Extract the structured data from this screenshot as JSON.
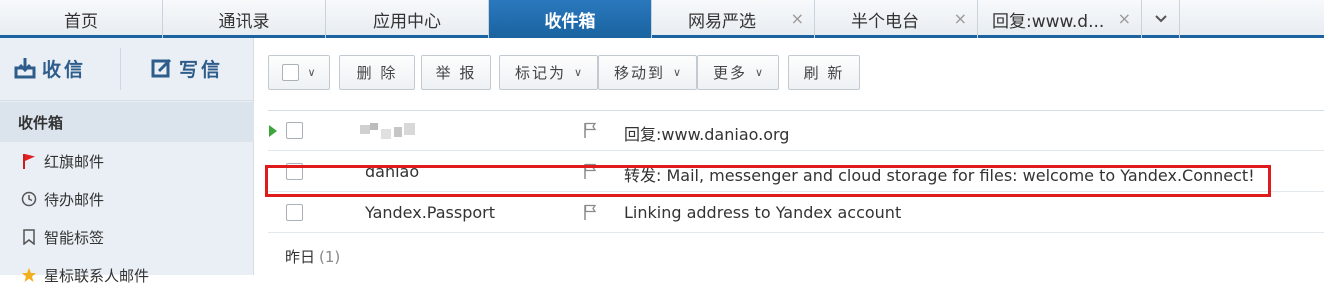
{
  "tabs": [
    {
      "label": "首页"
    },
    {
      "label": "通讯录"
    },
    {
      "label": "应用中心"
    },
    {
      "label": "收件箱"
    },
    {
      "label": "网易严选"
    },
    {
      "label": "半个电台"
    },
    {
      "label": "回复:www.d..."
    }
  ],
  "tab_close_symbol": "×",
  "sidebar": {
    "receive_label": "收信",
    "compose_label": "写信",
    "items": [
      {
        "label": "收件箱"
      },
      {
        "label": "红旗邮件",
        "icon": "red-flag-icon"
      },
      {
        "label": "待办邮件",
        "icon": "clock-icon"
      },
      {
        "label": "智能标签",
        "icon": "bookmark-icon"
      },
      {
        "label": "星标联系人邮件",
        "icon": "star-icon"
      }
    ]
  },
  "toolbar": {
    "delete_label": "删 除",
    "report_label": "举 报",
    "mark_as_label": "标记为",
    "move_to_label": "移动到",
    "more_label": "更多",
    "refresh_label": "刷 新",
    "caret": "∨"
  },
  "mails": [
    {
      "sender": "",
      "subject": "回复:www.daniao.org",
      "unread": true
    },
    {
      "sender": "daniao",
      "subject": "转发: Mail, messenger and cloud storage for files: welcome to Yandex.Connect!",
      "unread": false
    },
    {
      "sender": "Yandex.Passport",
      "subject": "Linking address to Yandex account",
      "unread": false
    }
  ],
  "group": {
    "label": "昨日",
    "count": "(1)"
  },
  "colors": {
    "accent": "#1a63a0",
    "highlight": "#e01b1b",
    "flag": "#e02020"
  }
}
